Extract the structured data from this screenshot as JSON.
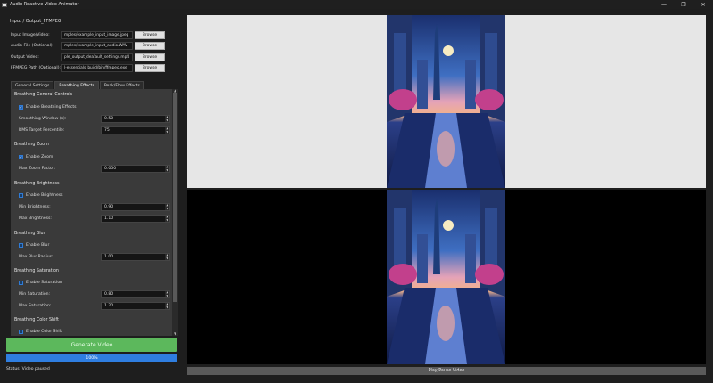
{
  "window": {
    "title": "Audio Reactive Video Animator",
    "controls": {
      "minimize": "—",
      "maximize": "❐",
      "close": "✕"
    }
  },
  "io_group": {
    "title": "Input / Output_FFMPEG",
    "rows": [
      {
        "label": "Input Image/Video:",
        "value": "mples/example_input_image.jpeg",
        "button": "Browse"
      },
      {
        "label": "Audio File (Optional):",
        "value": "mples/example_input_audio.WAV",
        "button": "Browse"
      },
      {
        "label": "Output Video:",
        "value": "ple_output_deafault_settings.mp4",
        "button": "Browse"
      },
      {
        "label": "FFMPEG Path (Optional):",
        "value": "l-essentials_build/bin/ffmpeg.exe",
        "button": "Browse"
      }
    ]
  },
  "tabs": [
    {
      "label": "General Settings",
      "active": false
    },
    {
      "label": "Breathing Effects",
      "active": true
    },
    {
      "label": "Peak/Flow Effects",
      "active": false
    }
  ],
  "breathing": {
    "general": {
      "title": "Breathing General Controls",
      "enable_label": "Enable Breathing Effects",
      "smoothing_label": "Smoothing Window (s):",
      "smoothing_value": "0.50",
      "rms_label": "RMS Target Percentile:",
      "rms_value": "75"
    },
    "zoom": {
      "title": "Breathing Zoom",
      "enable_label": "Enable Zoom",
      "max_label": "Max Zoom Factor:",
      "max_value": "0.050"
    },
    "brightness": {
      "title": "Breathing Brightness",
      "enable_label": "Enable Brightness",
      "min_label": "Min Brightness:",
      "min_value": "0.90",
      "max_label": "Max Brightness:",
      "max_value": "1.10"
    },
    "blur": {
      "title": "Breathing Blur",
      "enable_label": "Enable Blur",
      "max_label": "Max Blur Radius:",
      "max_value": "1.00"
    },
    "saturation": {
      "title": "Breathing Saturation",
      "enable_label": "Enable Saturation",
      "min_label": "Min Saturation:",
      "min_value": "0.80",
      "max_label": "Max Saturation:",
      "max_value": "1.20"
    },
    "color_shift": {
      "title": "Breathing Color Shift",
      "enable_label": "Enable Color Shift"
    }
  },
  "actions": {
    "generate_label": "Generate Video",
    "progress_percent": 100,
    "progress_text": "100%",
    "status_text": "Status: Video paused",
    "play_pause_label": "Play/Pause Video"
  },
  "colors": {
    "generate": "#5cb85c",
    "progress": "#2f7ee0",
    "checkbox": "#1e5fb0"
  }
}
